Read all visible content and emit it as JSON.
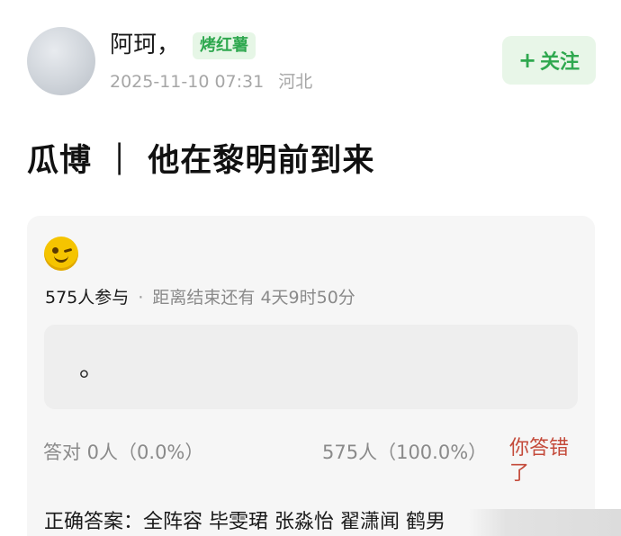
{
  "post": {
    "username": "阿珂，",
    "tag": "烤红薯",
    "timestamp": "2025-11-10 07:31",
    "location": "河北",
    "follow_label": "关注",
    "follow_icon": "plus-icon",
    "title": "瓜博 ｜ 他在黎明前到来"
  },
  "quiz": {
    "emoji": "winking-face-icon",
    "participants": "575人参与",
    "separator": "·",
    "countdown": "距离结束还有 4天9时50分",
    "answer_text": "。",
    "correct_stat": "答对  0人（0.0%）",
    "wrong_stat": "575人（100.0%）",
    "result_label": "你答错了",
    "correct_answer": "正确答案：全阵容 毕雯珺 张淼怡 翟潇闻 鹤男"
  },
  "colors": {
    "accent_green": "#2fa84f",
    "wrong_red": "#c44a3a",
    "card_bg": "#f6f6f6"
  }
}
